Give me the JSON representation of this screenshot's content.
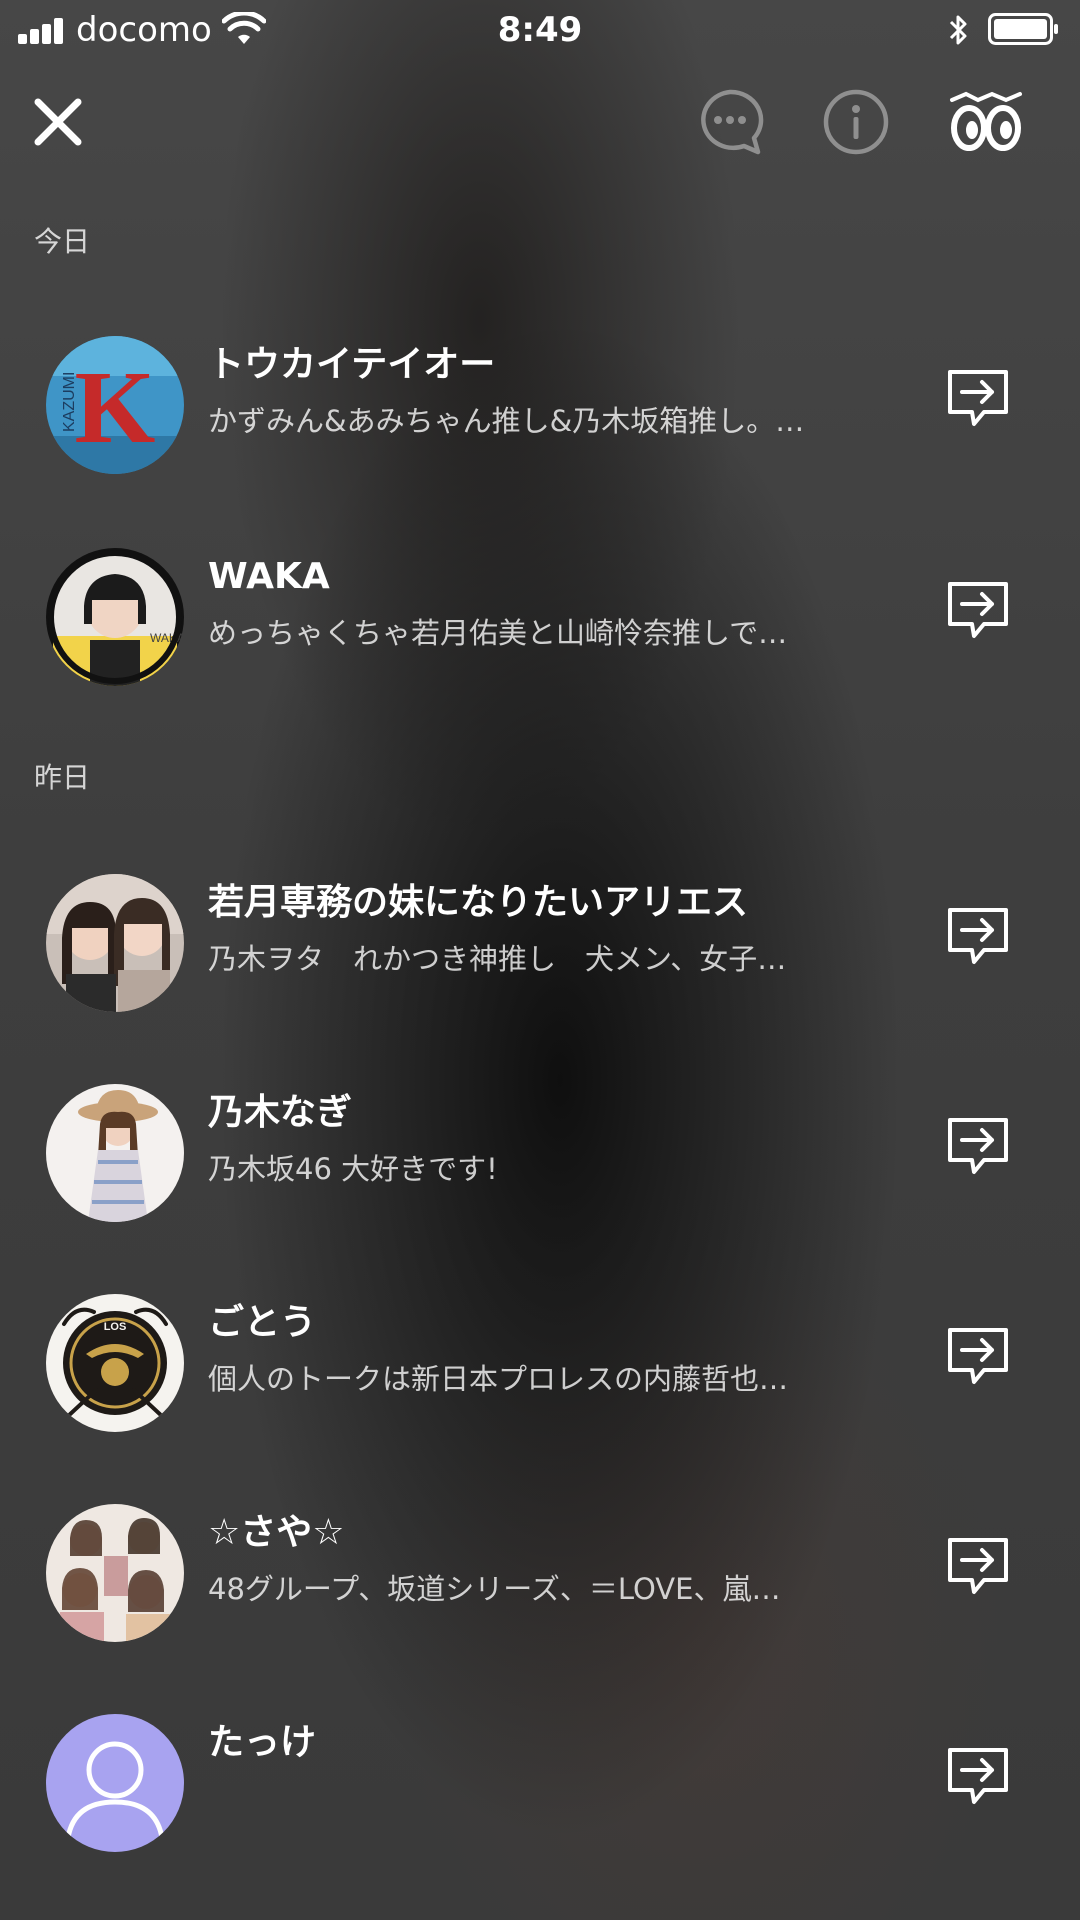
{
  "status_bar": {
    "carrier": "docomo",
    "time": "8:49"
  },
  "header": {
    "close_icon": "close-icon",
    "chat_icon": "chat-bubble-icon",
    "info_icon": "info-icon",
    "timeline_icon": "timeline-eyes-icon"
  },
  "sections": {
    "today": "今日",
    "yesterday": "昨日"
  },
  "users": [
    {
      "name": "トウカイテイオー",
      "status": "かずみん&あみちゃん推し&乃木坂箱推し。…"
    },
    {
      "name": "WAKA",
      "status": "めっちゃくちゃ若月佑美と山崎怜奈推しで…"
    },
    {
      "name": "若月専務の妹になりたいアリエス",
      "status": "乃木ヲタ　れかつき神推し　犬メン、女子…"
    },
    {
      "name": "乃木なぎ",
      "status": "乃木坂46  大好きです!"
    },
    {
      "name": "ごとう",
      "status": "個人のトークは新日本プロレスの内藤哲也…"
    },
    {
      "name": "☆さや☆",
      "status": "48グループ、坂道シリーズ、＝LOVE、嵐…"
    },
    {
      "name": "たっけ",
      "status": ""
    }
  ],
  "colors": {
    "default_avatar": "#a8a3f0",
    "text_primary": "#ffffff",
    "text_secondary": "#cfcfcf"
  }
}
